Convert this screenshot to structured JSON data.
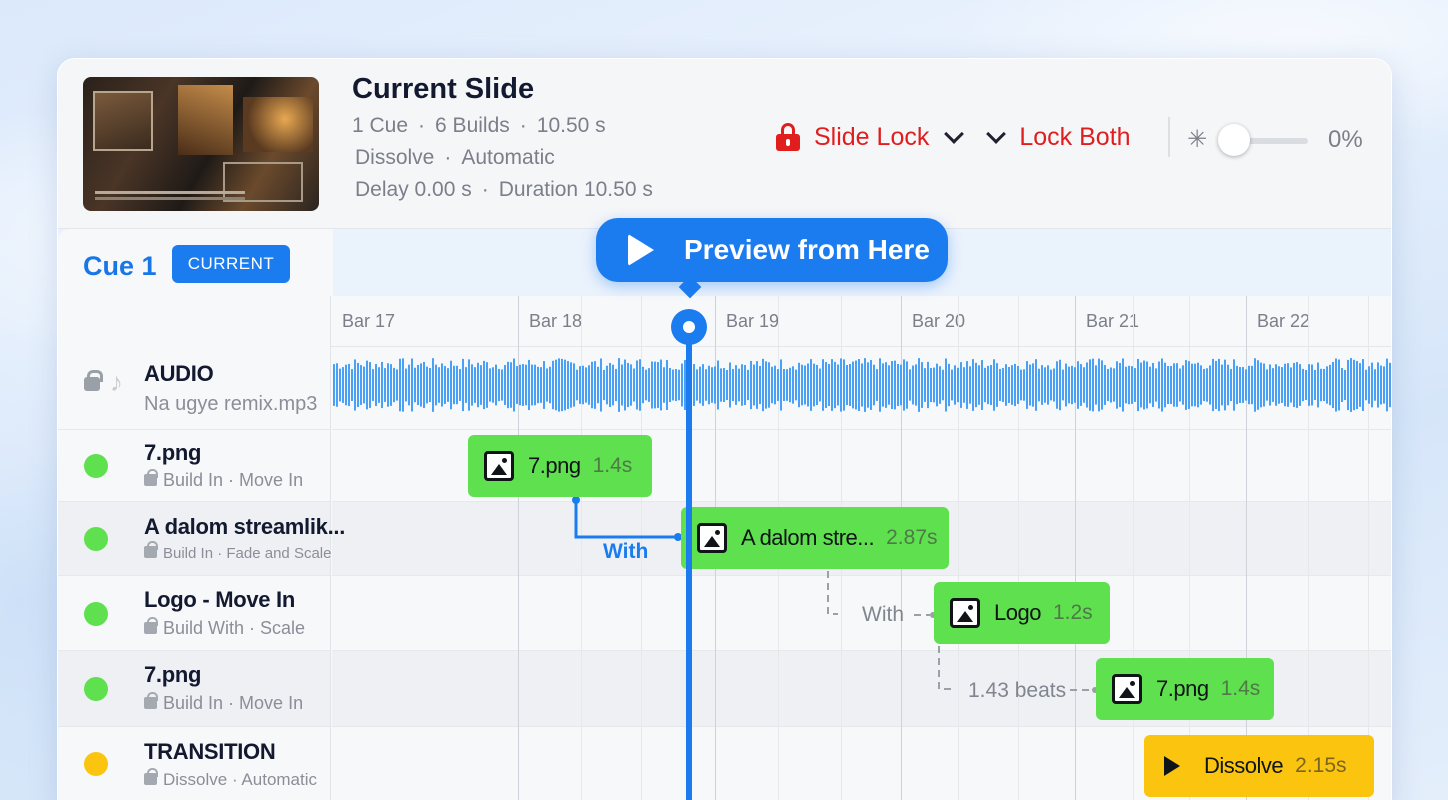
{
  "header": {
    "title": "Current Slide",
    "meta_line1": [
      "1 Cue",
      "6 Builds",
      "10.50 s"
    ],
    "meta_line2": [
      "Dissolve",
      "Automatic"
    ],
    "meta_line3": [
      "Delay 0.00 s",
      "Duration 10.50 s"
    ],
    "slide_lock_label": "Slide Lock",
    "lock_both_label": "Lock Both",
    "opacity_value": "0%",
    "opacity_level": 0
  },
  "cue": {
    "title": "Cue 1",
    "badge": "CURRENT",
    "preview_label": "Preview from Here"
  },
  "ruler": [
    "Bar 17",
    "Bar 18",
    "Bar 19",
    "Bar 20",
    "Bar 21",
    "Bar 22"
  ],
  "rows": [
    {
      "name": "AUDIO",
      "sub": "Na ugye remix.mp3"
    },
    {
      "name": "7.png",
      "sub_a": "Build In",
      "sub_b": "Move In"
    },
    {
      "name": "A dalom streamlik...",
      "sub_a": "Build In",
      "sub_b": "Fade and Scale"
    },
    {
      "name": "Logo - Move In",
      "sub_a": "Build With",
      "sub_b": "Scale"
    },
    {
      "name": "7.png",
      "sub_a": "Build In",
      "sub_b": "Move In"
    },
    {
      "name": "TRANSITION",
      "sub_a": "Dissolve",
      "sub_b": "Automatic"
    }
  ],
  "blocks": [
    {
      "name": "7.png",
      "dur": "1.4s"
    },
    {
      "name": "A dalom stre...",
      "dur": "2.87s"
    },
    {
      "name": "Logo",
      "dur": "1.2s"
    },
    {
      "name": "7.png",
      "dur": "1.4s"
    },
    {
      "name": "Dissolve",
      "dur": "2.15s"
    }
  ],
  "connectors": {
    "with_1": "With",
    "with_2": "With",
    "beats": "1.43 beats"
  },
  "colors": {
    "accent": "#1b7cf0",
    "lock_red": "#e01e1e",
    "build_green": "#5fe04e",
    "transition_yellow": "#fbc50f"
  }
}
